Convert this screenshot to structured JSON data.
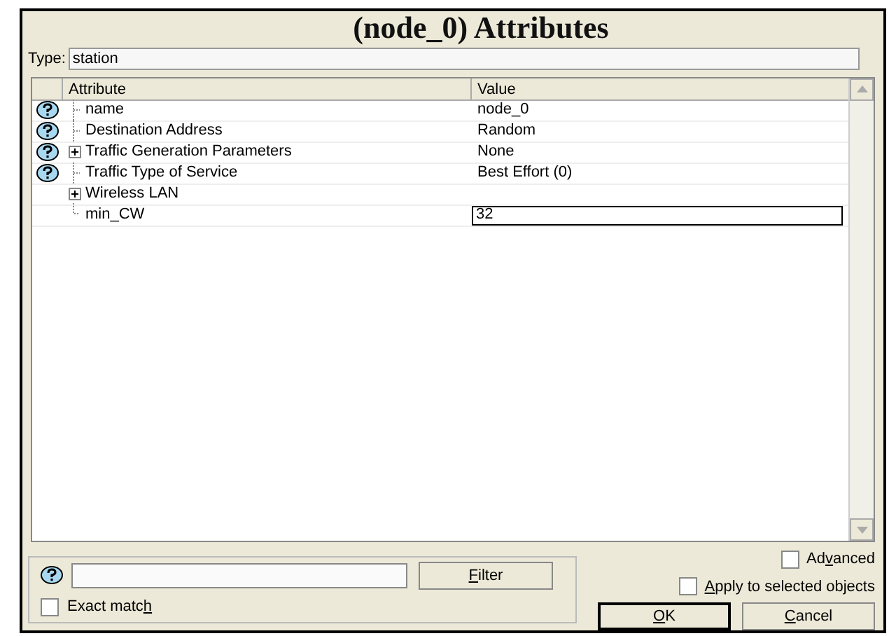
{
  "window": {
    "title": "(node_0) Attributes"
  },
  "type_field": {
    "label": "Type:",
    "value": "station"
  },
  "table": {
    "columns": [
      "Attribute",
      "Value"
    ],
    "rows": [
      {
        "help": true,
        "kind": "leaf",
        "attribute": "name",
        "value": "node_0",
        "editing": false
      },
      {
        "help": true,
        "kind": "leaf",
        "attribute": "Destination Address",
        "value": "Random",
        "editing": false
      },
      {
        "help": true,
        "kind": "group",
        "attribute": "Traffic Generation Parameters",
        "value": "None",
        "editing": false
      },
      {
        "help": true,
        "kind": "leaf",
        "attribute": "Traffic Type of Service",
        "value": "Best Effort (0)",
        "editing": false
      },
      {
        "help": false,
        "kind": "group",
        "attribute": "Wireless LAN",
        "editing": false
      },
      {
        "help": false,
        "kind": "last",
        "attribute": "min_CW",
        "value": "32",
        "editing": true
      }
    ]
  },
  "filter": {
    "button": [
      {
        "text": "F",
        "underline": true
      },
      {
        "text": "ilter",
        "underline": false
      }
    ],
    "exact_match": {
      "label": [
        {
          "text": "Exact matc",
          "underline": false
        },
        {
          "text": "h",
          "underline": true
        }
      ],
      "checked": false
    }
  },
  "advanced": {
    "label": [
      {
        "text": "Ad",
        "underline": false
      },
      {
        "text": "v",
        "underline": true
      },
      {
        "text": "anced",
        "underline": false
      }
    ],
    "checked": false
  },
  "apply_selected": {
    "label": [
      {
        "text": "A",
        "underline": true
      },
      {
        "text": "pply to selected objects",
        "underline": false
      }
    ],
    "checked": false
  },
  "buttons": [
    [
      {
        "text": "O",
        "underline": true
      },
      {
        "text": "K",
        "underline": false
      }
    ],
    [
      {
        "text": "C",
        "underline": true
      },
      {
        "text": "ancel",
        "underline": false
      }
    ]
  ]
}
